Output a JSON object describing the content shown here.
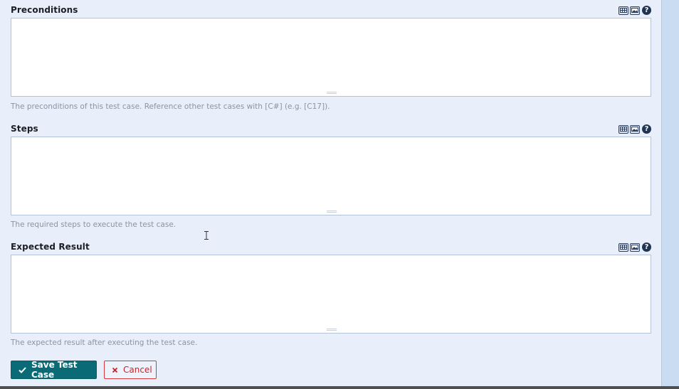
{
  "fields": [
    {
      "label": "Preconditions",
      "hint": "The preconditions of this test case. Reference other test cases with [C#] (e.g. [C17]).",
      "value": ""
    },
    {
      "label": "Steps",
      "hint": "The required steps to execute the test case.",
      "value": ""
    },
    {
      "label": "Expected Result",
      "hint": "The expected result after executing the test case.",
      "value": ""
    }
  ],
  "toolbar": {
    "table_icon": "table-icon",
    "image_icon": "image-icon",
    "help_icon": "help-icon",
    "help_glyph": "?"
  },
  "actions": {
    "save_label": "Save Test Case",
    "cancel_label": "Cancel"
  },
  "colors": {
    "save_bg": "#0a6b77",
    "cancel_border": "#d23a3f",
    "cancel_text": "#c0262c",
    "page_bg": "#e9eefb"
  }
}
